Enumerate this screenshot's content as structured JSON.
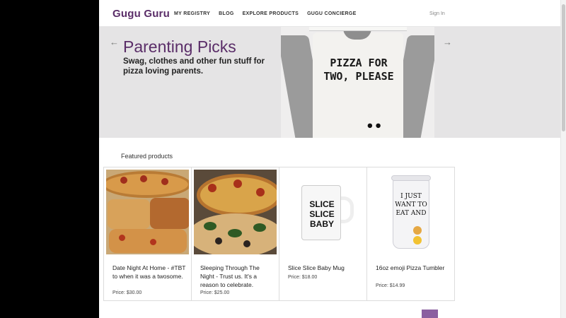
{
  "header": {
    "logo": "Gugu Guru",
    "nav": [
      "MY REGISTRY",
      "BLOG",
      "EXPLORE PRODUCTS",
      "GUGU CONCIERGE"
    ],
    "signin": "Sign In"
  },
  "hero": {
    "title": "Parenting Picks",
    "subtitle": "Swag, clothes and other fun stuff for pizza loving parents.",
    "shirt_text": "PIZZA FOR TWO, PLEASE",
    "prev_icon": "arrow-left-icon",
    "next_icon": "arrow-right-icon"
  },
  "featured": {
    "title": "Featured products",
    "items": [
      {
        "name": "Date Night At Home - #TBT to when it was a twosome.",
        "price": "Price: $30.00"
      },
      {
        "name": "Sleeping Through The Night - Trust us. It's a reason to celebrate.",
        "price": "Price: $25.00"
      },
      {
        "name": "Slice Slice Baby Mug",
        "price": "Price: $18.00"
      },
      {
        "name": "16oz emoji Pizza Tumbler",
        "price": "Price: $14.99"
      }
    ],
    "mug_text": "SLICE SLICE BABY",
    "tumbler_text": "I JUST WANT TO EAT AND"
  },
  "colors": {
    "brand": "#5a2d68",
    "accent": "#8b5fa0",
    "hero_bg": "#e5e4e5"
  }
}
